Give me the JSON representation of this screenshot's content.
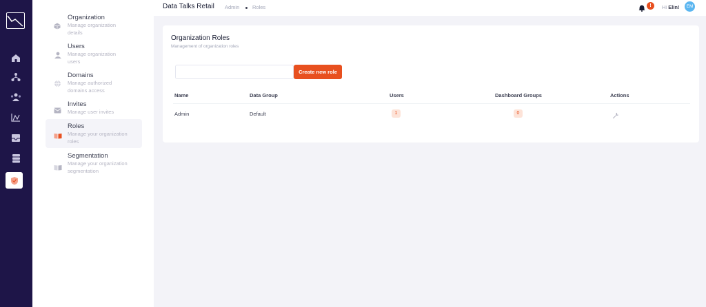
{
  "header": {
    "app_name": "Data Talks Retail",
    "breadcrumb": [
      "Admin",
      "Roles"
    ],
    "notifications": {
      "count": "!"
    },
    "greeting_prefix": "Hi",
    "user_name": "Elin!",
    "avatar_initials": "EM"
  },
  "rail": {
    "icons": [
      "home-icon",
      "hierarchy-icon",
      "users-group-icon",
      "analytics-icon",
      "inbox-icon",
      "database-icon",
      "shield-icon"
    ],
    "active": "shield-icon"
  },
  "menu": {
    "items": [
      {
        "title": "Organization",
        "description": "Manage organization details",
        "icon": "cube-icon"
      },
      {
        "title": "Users",
        "description": "Manage organization users",
        "icon": "user-icon"
      },
      {
        "title": "Domains",
        "description": "Manage authorized domains access",
        "icon": "globe-icon"
      },
      {
        "title": "Invites",
        "description": "Manage user invites",
        "icon": "envelope-icon"
      },
      {
        "title": "Roles",
        "description": "Manage your organization roles",
        "icon": "book-icon"
      },
      {
        "title": "Segmentation",
        "description": "Manage your organization segmentation",
        "icon": "book-icon"
      }
    ],
    "active_index": 4
  },
  "card": {
    "title": "Organization Roles",
    "subtitle": "Management of organization roles",
    "search": {
      "value": "",
      "placeholder": ""
    },
    "create_button": "Create new role",
    "table": {
      "columns": [
        "Name",
        "Data Group",
        "Users",
        "Dashboard Groups",
        "Actions"
      ],
      "rows": [
        {
          "name": "Admin",
          "data_group": "Default",
          "users": "1",
          "dashboard_groups": "0",
          "action_icon": "wrench-icon"
        }
      ]
    }
  },
  "colors": {
    "rail_bg": "#1e1548",
    "accent": "#e8501f",
    "badge_bg": "#fde3d8",
    "avatar_bg": "#5bb6f0"
  }
}
